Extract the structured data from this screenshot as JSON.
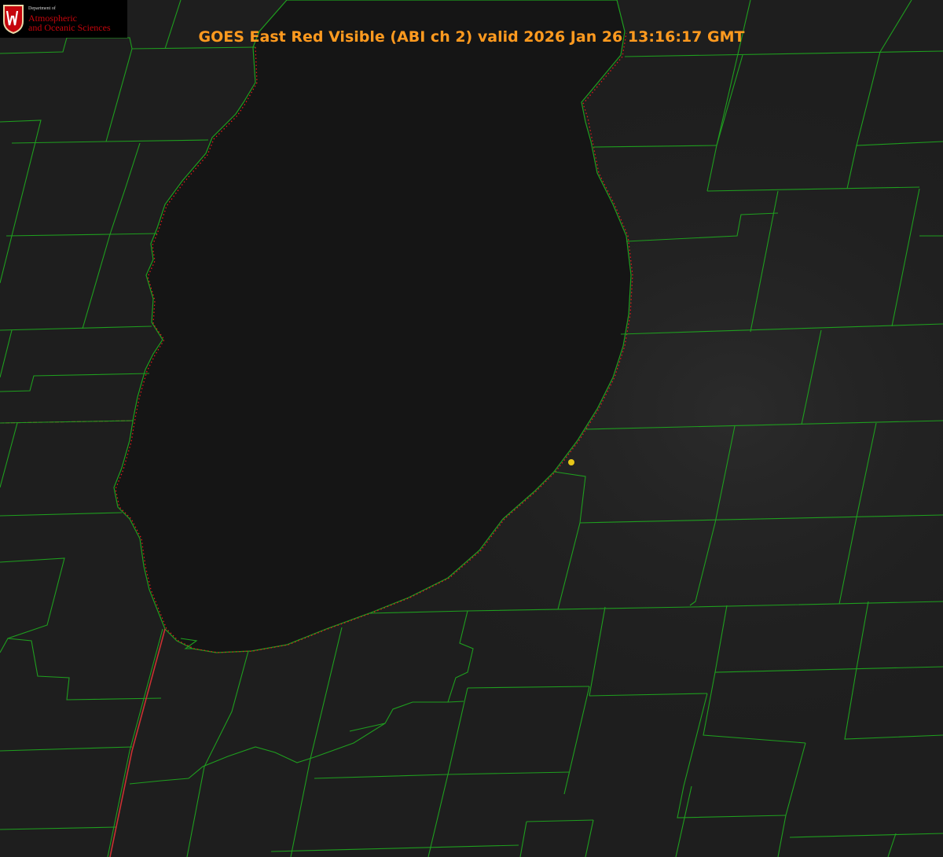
{
  "title": "GOES East Red Visible (ABI ch 2) valid 2026 Jan 26 13:16:17 GMT",
  "logo": {
    "department": "Department of",
    "line1": "Atmospheric",
    "line2": "and Oceanic Sciences",
    "icon": "uw-crest-icon"
  },
  "colors": {
    "background": "#1e1e1e",
    "lake": "#151515",
    "county_lines": "#1f9e1f",
    "shoreline": "#e01c1c",
    "state_line": "#c83232",
    "title": "#ff9a1f",
    "marker": "#e6c619",
    "logo_red": "#c5050c"
  },
  "marker": {
    "name": "station-marker",
    "shape": "dot"
  }
}
